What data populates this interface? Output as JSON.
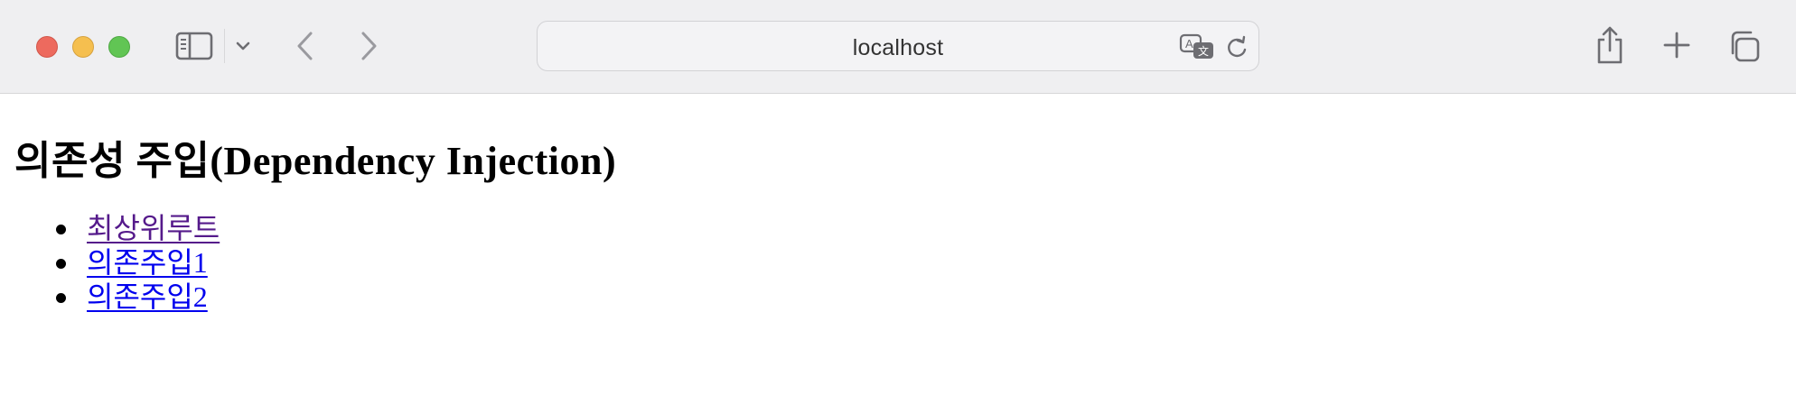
{
  "browser": {
    "address": "localhost",
    "icons": {
      "close": "close-window-icon",
      "minimize": "minimize-window-icon",
      "zoom": "zoom-window-icon",
      "sidebar": "sidebar-icon",
      "chevron": "chevron-down-icon",
      "back": "back-arrow-icon",
      "forward": "forward-arrow-icon",
      "translate": "translate-icon",
      "reload": "reload-icon",
      "share": "share-icon",
      "new_tab": "plus-icon",
      "tabs": "tab-overview-icon"
    },
    "colors": {
      "close": "#ed6a5e",
      "minimize": "#f5bf4f",
      "zoom": "#61c554",
      "toolbar": "#efeff1"
    }
  },
  "page": {
    "title": "의존성 주입(Dependency Injection)",
    "links": [
      {
        "label": "최상위루트",
        "visited": true
      },
      {
        "label": "의존주입1",
        "visited": false
      },
      {
        "label": "의존주입2",
        "visited": false
      }
    ],
    "colors": {
      "visited_link": "#551a8b",
      "link": "#0000ee"
    }
  }
}
